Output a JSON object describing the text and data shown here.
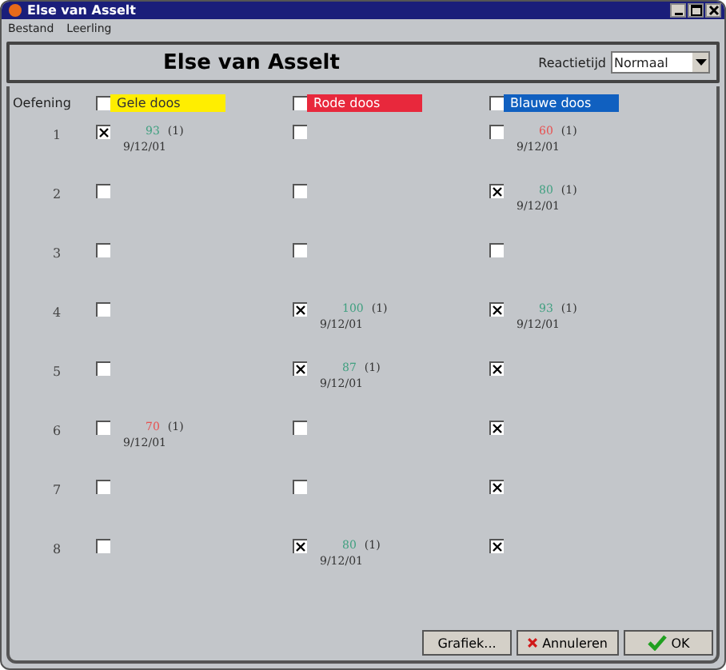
{
  "window": {
    "title": "Else van Asselt"
  },
  "menu": [
    "Bestand",
    "Leerling"
  ],
  "header": {
    "name": "Else van Asselt",
    "reaction_label": "Reactietijd",
    "reaction_value": "Normaal"
  },
  "columns_label": "Oefening",
  "columns": [
    {
      "label": "Gele doos",
      "color": "#ffee00",
      "checked": false
    },
    {
      "label": "Rode doos",
      "color": "#e8283c",
      "checked": false
    },
    {
      "label": "Blauwe doos",
      "color": "#1060c0",
      "checked": false
    }
  ],
  "rows": [
    {
      "number": "1",
      "cells": [
        {
          "checked": true,
          "score": "93",
          "color": "#40a080",
          "count": "(1)",
          "date": "9/12/01"
        },
        {
          "checked": false
        },
        {
          "checked": false,
          "score": "60",
          "color": "#e85050",
          "count": "(1)",
          "date": "9/12/01"
        }
      ]
    },
    {
      "number": "2",
      "cells": [
        {
          "checked": false
        },
        {
          "checked": false
        },
        {
          "checked": true,
          "score": "80",
          "color": "#40a080",
          "count": "(1)",
          "date": "9/12/01"
        }
      ]
    },
    {
      "number": "3",
      "cells": [
        {
          "checked": false
        },
        {
          "checked": false
        },
        {
          "checked": false
        }
      ]
    },
    {
      "number": "4",
      "cells": [
        {
          "checked": false
        },
        {
          "checked": true,
          "score": "100",
          "color": "#40a080",
          "count": "(1)",
          "date": "9/12/01"
        },
        {
          "checked": true,
          "score": "93",
          "color": "#40a080",
          "count": "(1)",
          "date": "9/12/01"
        }
      ]
    },
    {
      "number": "5",
      "cells": [
        {
          "checked": false
        },
        {
          "checked": true,
          "score": "87",
          "color": "#40a080",
          "count": "(1)",
          "date": "9/12/01"
        },
        {
          "checked": true
        }
      ]
    },
    {
      "number": "6",
      "cells": [
        {
          "checked": false,
          "score": "70",
          "color": "#e85050",
          "count": "(1)",
          "date": "9/12/01"
        },
        {
          "checked": false
        },
        {
          "checked": true
        }
      ]
    },
    {
      "number": "7",
      "cells": [
        {
          "checked": false
        },
        {
          "checked": false
        },
        {
          "checked": true
        }
      ]
    },
    {
      "number": "8",
      "cells": [
        {
          "checked": false
        },
        {
          "checked": true,
          "score": "80",
          "color": "#40a080",
          "count": "(1)",
          "date": "9/12/01"
        },
        {
          "checked": true
        }
      ]
    }
  ],
  "buttons": [
    {
      "label": "Grafiek...",
      "kind": "plain"
    },
    {
      "label": "Annuleren",
      "kind": "cancel"
    },
    {
      "label": "OK",
      "kind": "ok"
    }
  ]
}
